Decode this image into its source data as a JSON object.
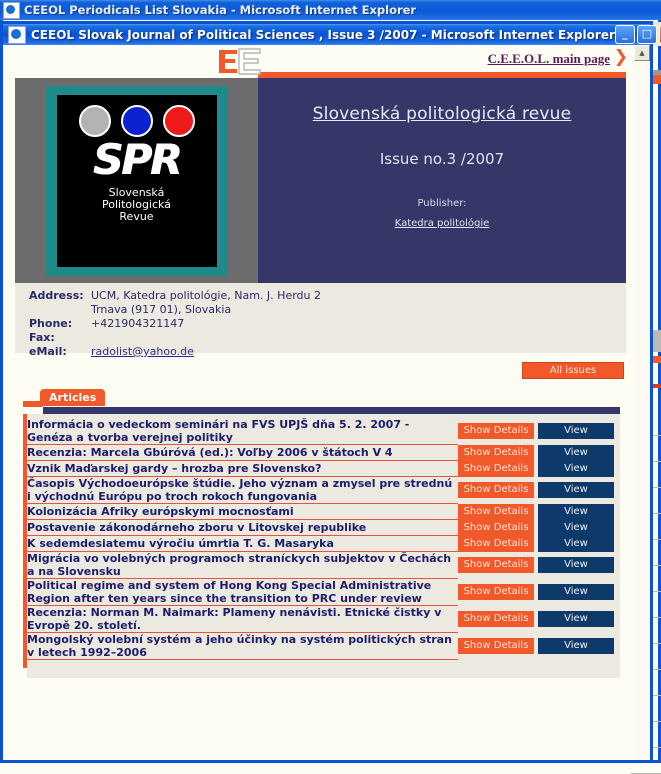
{
  "background_window": {
    "title": "CEEOL Periodicals List Slovakia - Microsoft Internet Explorer",
    "icon": "ie-document-icon"
  },
  "window": {
    "title": "CEEOL Slovak Journal of Political Sciences , Issue 3 /2007 - Microsoft Internet Explorer",
    "icon": "ie-document-icon",
    "buttons": {
      "minimize": "_",
      "maximize": "□",
      "close": "✕"
    }
  },
  "topbar": {
    "logo_name": "ceeol-logo",
    "main_page_link": "C.E.E.O.L. main page",
    "chevron": "❯"
  },
  "banner": {
    "logo": {
      "dots": [
        "#b3b3b3",
        "#0a22cf",
        "#ef1b1b"
      ],
      "acronym": "SPR",
      "subtitle_lines": [
        "Slovenská",
        "Politologická",
        "Revue"
      ]
    },
    "journal_title": "Slovenská politologická revue",
    "issue": "Issue no.3 /2007",
    "publisher_label": "Publisher:",
    "publisher_link": "Katedra politológie"
  },
  "contact": {
    "rows": [
      {
        "label": "Address:",
        "value": "UCM, Katedra politológie, Nam. J. Herdu 2"
      },
      {
        "label": "",
        "value": "Trnava (917 01), Slovakia"
      },
      {
        "label": "Phone:",
        "value": "+421904321147"
      },
      {
        "label": "Fax:",
        "value": ""
      }
    ],
    "email_label": "eMail:",
    "email": "radolist@yahoo.de"
  },
  "all_issues_button": "All issues",
  "tab": {
    "label": "Articles"
  },
  "buttons": {
    "show_details": "Show Details",
    "view": "View"
  },
  "articles": [
    {
      "title": "Informácia o vedeckom seminári na FVS UPJŠ dňa 5. 2. 2007 - Genéza a tvorba verejnej politiky"
    },
    {
      "title": "Recenzia: Marcela Gbúróvá (ed.): Voľby 2006 v štátoch V 4"
    },
    {
      "title": "Vznik Maďarskej gardy – hrozba pre Slovensko?"
    },
    {
      "title": "Časopis Východoeurópske štúdie. Jeho význam a zmysel pre strednú i východnú Európu po troch rokoch fungovania"
    },
    {
      "title": "Kolonizácia Afriky európskymi mocnosťami"
    },
    {
      "title": "Postavenie zákonodárneho zboru v Litovskej republike"
    },
    {
      "title": "K sedemdesiatemu výročiu úmrtia T. G. Masaryka"
    },
    {
      "title": "Migrácia vo volebných programoch straníckych subjektov v Čechách a na Slovensku"
    },
    {
      "title": "Political regime and system of Hong Kong Special Administrative Region after ten years since the transition to PRC under review"
    },
    {
      "title": "Recenzia: Norman M. Naimark: Plameny nenávisti. Etnické čistky v Evropě 20. století."
    },
    {
      "title": "Mongolský volební systém a jeho účinky na systém politických stran v letech 1992–2006"
    }
  ],
  "colors": {
    "orange": "#f1592a",
    "navy": "#363668",
    "view_blue": "#0d3a6b",
    "panel_bg": "#ece9e0",
    "page_bg": "#fdfdf4",
    "title_link": "#5b1a5b",
    "row_rule": "#e8543a",
    "teal": "#1f8a8a"
  },
  "scrollbar": {
    "up_arrow": "▲"
  }
}
